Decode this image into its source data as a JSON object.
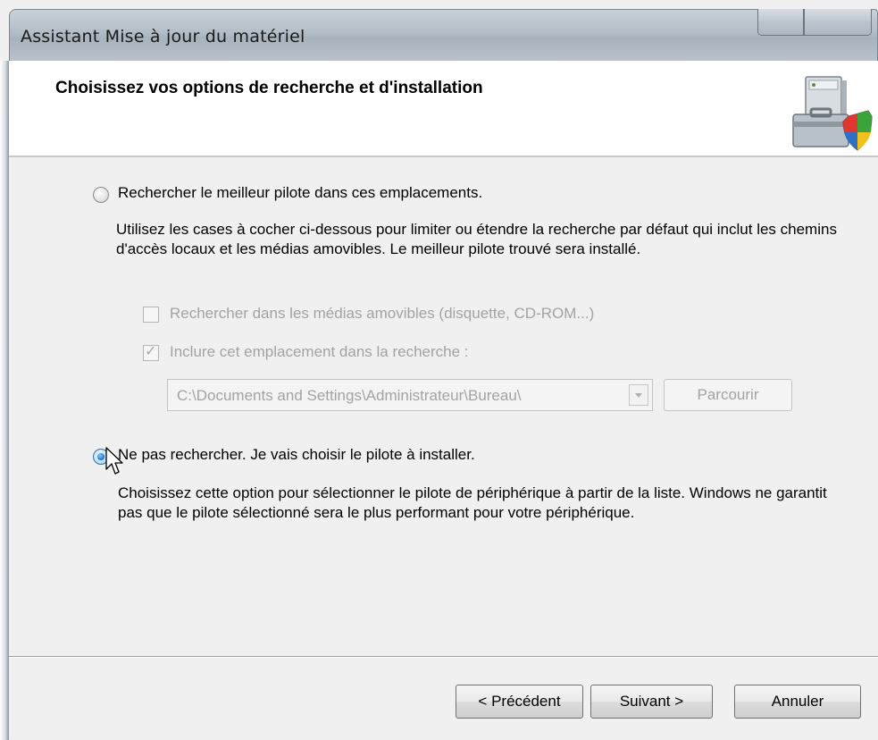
{
  "window": {
    "title": "Assistant Mise à jour du matériel"
  },
  "header": {
    "title": "Choisissez vos options de recherche et d'installation",
    "icon": "hardware-shield-icon"
  },
  "options": {
    "search": {
      "label": "Rechercher le meilleur pilote dans ces emplacements.",
      "selected": false,
      "description": "Utilisez les cases à cocher ci-dessous pour limiter ou étendre la recherche par défaut qui inclut les chemins d'accès locaux et les médias amovibles. Le meilleur pilote trouvé sera installé.",
      "removable_media": {
        "label": "Rechercher dans les médias amovibles (disquette, CD-ROM...)",
        "checked": false
      },
      "include_location": {
        "label": "Inclure cet emplacement dans la recherche :",
        "checked": true
      },
      "path_value": "C:\\Documents and Settings\\Administrateur\\Bureau\\",
      "browse_label": "Parcourir"
    },
    "manual": {
      "label": "Ne pas rechercher. Je vais choisir le pilote à installer.",
      "selected": true,
      "description": "Choisissez cette option pour sélectionner le pilote de périphérique à partir de la liste. Windows ne garantit pas que le pilote sélectionné sera le plus performant pour votre périphérique."
    }
  },
  "buttons": {
    "back": "< Précédent",
    "next": "Suivant >",
    "cancel": "Annuler"
  },
  "colors": {
    "accent": "#1b6fc1",
    "disabled_text": "#a3a3a3"
  }
}
